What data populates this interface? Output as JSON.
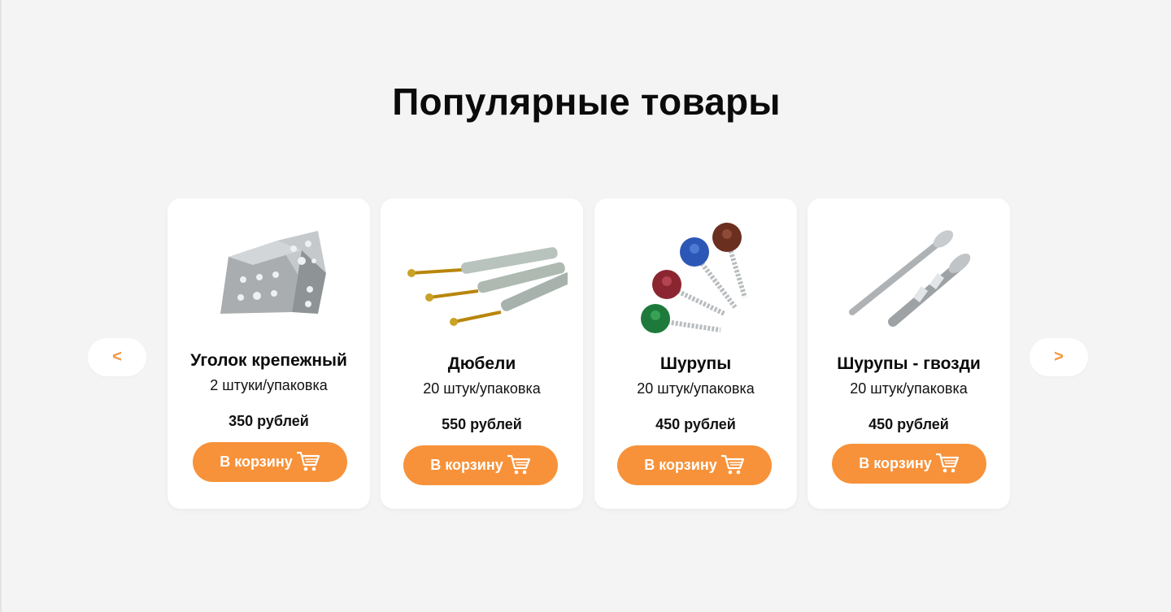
{
  "section": {
    "title": "Популярные товары",
    "prev_label": "<",
    "next_label": ">"
  },
  "products": [
    {
      "name": "Уголок крепежный",
      "pack": "2 штуки/упаковка",
      "price": "350 рублей",
      "button": "В корзину",
      "icon": "angle-bracket-image"
    },
    {
      "name": "Дюбели",
      "pack": "20 штук/упаковка",
      "price": "550 рублей",
      "button": "В корзину",
      "icon": "dowels-image"
    },
    {
      "name": "Шурупы",
      "pack": "20 штук/упаковка",
      "price": "450 рублей",
      "button": "В корзину",
      "icon": "roofing-screws-image"
    },
    {
      "name": "Шурупы - гвозди",
      "pack": "20 штук/упаковка",
      "price": "450 рублей",
      "button": "В корзину",
      "icon": "anchor-screw-nails-image"
    }
  ],
  "colors": {
    "accent": "#f7923a",
    "background": "#f3f4f3",
    "card": "#ffffff"
  }
}
